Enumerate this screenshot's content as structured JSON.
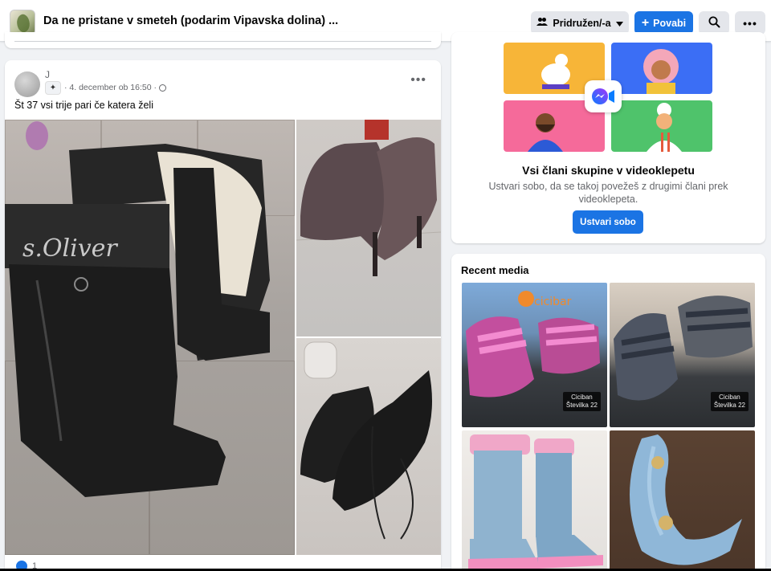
{
  "header": {
    "group_name": "Da ne pristane v smeteh (podarim Vipavska dolina) ...",
    "joined_label": "Pridružen/-a",
    "invite_label": "Povabi"
  },
  "post": {
    "author": "J",
    "timestamp": "4. december ob 16:50",
    "text": "Št 37 vsi trije pari če katera želi",
    "reaction_count": "1",
    "photo_main_brand": "s.Oliver"
  },
  "video_chat": {
    "title": "Vsi člani skupine v videoklepetu",
    "description": "Ustvari sobo, da se takoj povežeš z drugimi člani prek videoklepeta.",
    "button_label": "Ustvari sobo"
  },
  "recent_media": {
    "title": "Recent media",
    "items": [
      {
        "label_line1": "Ciciban",
        "label_line2": "Številka 22"
      },
      {
        "label_line1": "Ciciban",
        "label_line2": "Številka 22"
      },
      {
        "label_line1": "",
        "label_line2": ""
      },
      {
        "label_line1": "",
        "label_line2": ""
      }
    ],
    "brand_text": "cicibar"
  },
  "colors": {
    "accent": "#1b74e4",
    "secondary_button": "#e4e6eb",
    "page_bg": "#f0f2f5"
  }
}
